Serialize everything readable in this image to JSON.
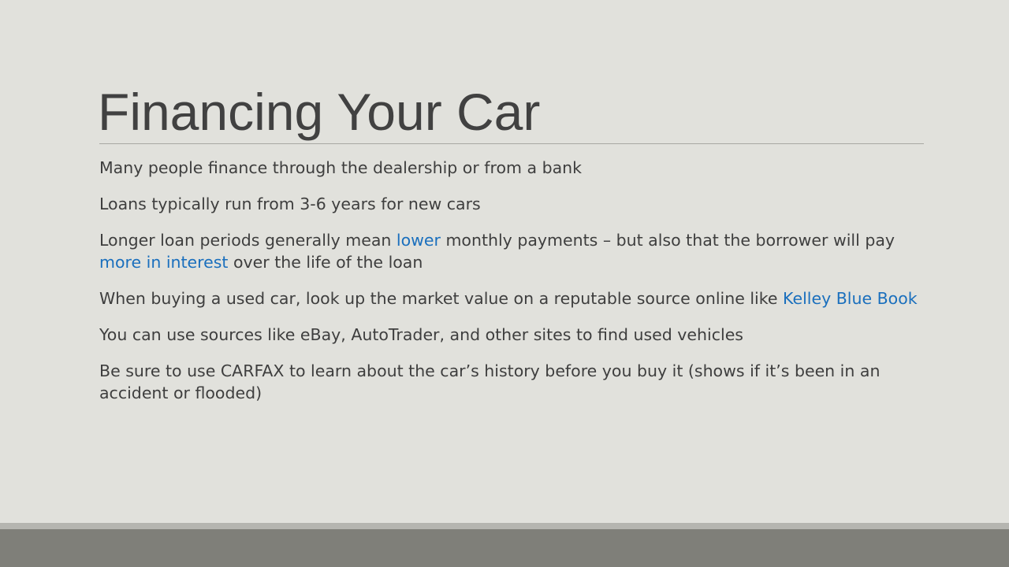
{
  "slide": {
    "title": "Financing Your Car",
    "bullets": [
      {
        "text": "Many people finance through the dealership or from a bank"
      },
      {
        "text": "Loans typically run from 3-6 years for new cars"
      },
      {
        "part1": "Longer loan periods generally mean ",
        "highlight1": "lower",
        "part2": " monthly payments – but also that the borrower will pay ",
        "highlight2": "more in interest",
        "part3": " over the life of the loan"
      },
      {
        "part1": "When buying a used car, look up the market value on a reputable source online like ",
        "highlight1": "Kelley Blue Book"
      },
      {
        "text": "You can use sources like eBay, AutoTrader, and other sites to find used vehicles"
      },
      {
        "text": "Be sure to use CARFAX to learn about the car’s history before you buy it (shows if it’s been in an accident or flooded)"
      }
    ]
  },
  "colors": {
    "background": "#e1e1dc",
    "title_text": "#414141",
    "body_text": "#3e3e3e",
    "highlight": "#1a6fbd",
    "footer_light": "#b5b5b0",
    "footer_dark": "#7f7f79"
  }
}
